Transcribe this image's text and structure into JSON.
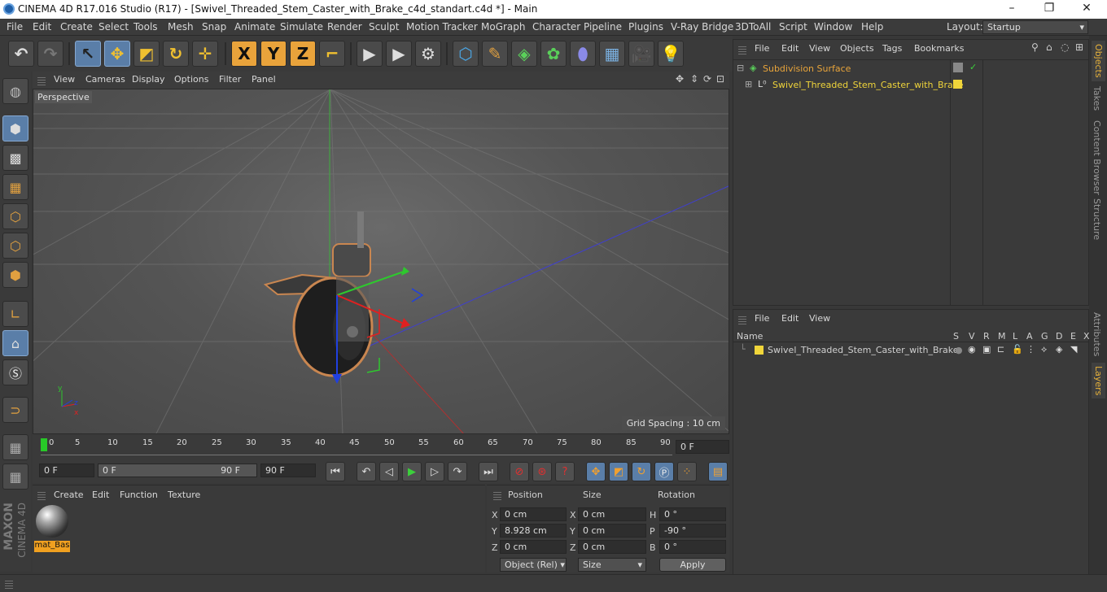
{
  "window": {
    "title": "CINEMA 4D R17.016 Studio (R17) - [Swivel_Threaded_Stem_Caster_with_Brake_c4d_standart.c4d *] - Main",
    "controls": [
      "–",
      "❐",
      "✕"
    ]
  },
  "menu": [
    "File",
    "Edit",
    "Create",
    "Select",
    "Tools",
    "Mesh",
    "Snap",
    "Animate",
    "Simulate",
    "Render",
    "Sculpt",
    "Motion Tracker",
    "MoGraph",
    "Character",
    "Pipeline",
    "Plugins",
    "V-Ray Bridge",
    "3DToAll",
    "Script",
    "Window",
    "Help"
  ],
  "layout": {
    "label": "Layout:",
    "value": "Startup"
  },
  "toolbar": {
    "axes": [
      "X",
      "Y",
      "Z"
    ]
  },
  "viewport": {
    "menu": [
      "View",
      "Cameras",
      "Display",
      "Options",
      "Filter",
      "Panel"
    ],
    "camera_label": "Perspective",
    "grid_spacing": "Grid Spacing : 10 cm",
    "axis_labels": {
      "x": "x",
      "y": "y",
      "z": "z"
    }
  },
  "timeline": {
    "ticks": [
      "0",
      "5",
      "10",
      "15",
      "20",
      "25",
      "30",
      "35",
      "40",
      "45",
      "50",
      "55",
      "60",
      "65",
      "70",
      "75",
      "80",
      "85",
      "90"
    ],
    "current_frame": "0 F"
  },
  "transport": {
    "start": "0 F",
    "range_start": "0 F",
    "range_end": "90 F",
    "end": "90 F"
  },
  "material_panel": {
    "menu": [
      "Create",
      "Edit",
      "Function",
      "Texture"
    ],
    "material_name": "mat_Bas"
  },
  "coords": {
    "headers": {
      "position": "Position",
      "size": "Size",
      "rotation": "Rotation"
    },
    "rows": [
      {
        "axis": "X",
        "pos": "0 cm",
        "size_axis": "X",
        "size": "0 cm",
        "rot_axis": "H",
        "rot": "0 °"
      },
      {
        "axis": "Y",
        "pos": "8.928 cm",
        "size_axis": "Y",
        "size": "0 cm",
        "rot_axis": "P",
        "rot": "-90 °"
      },
      {
        "axis": "Z",
        "pos": "0 cm",
        "size_axis": "Z",
        "size": "0 cm",
        "rot_axis": "B",
        "rot": "0 °"
      }
    ],
    "mode": "Object (Rel)",
    "size_mode": "Size",
    "apply": "Apply"
  },
  "object_manager": {
    "menu": [
      "File",
      "Edit",
      "View",
      "Objects",
      "Tags",
      "Bookmarks"
    ],
    "objects": [
      {
        "name": "Subdivision Surface",
        "color": "#e8a43a"
      },
      {
        "name": "Swivel_Threaded_Stem_Caster_with_Brake",
        "color": "#f0d53a"
      }
    ]
  },
  "layer_manager": {
    "menu": [
      "File",
      "Edit",
      "View"
    ],
    "columns": [
      "Name",
      "S",
      "V",
      "R",
      "M",
      "L",
      "A",
      "G",
      "D",
      "E",
      "X"
    ],
    "layers": [
      {
        "name": "Swivel_Threaded_Stem_Caster_with_Brake"
      }
    ]
  },
  "right_tabs": [
    "Objects",
    "Takes",
    "Content Browser",
    "Structure",
    "Attributes",
    "Layers"
  ],
  "branding": {
    "maxon": "MAXON",
    "product": "CINEMA 4D"
  },
  "colors": {
    "accent": "#e8b23a",
    "selected_tool": "#5a7ea8",
    "layer_swatch": "#f0d53a"
  }
}
